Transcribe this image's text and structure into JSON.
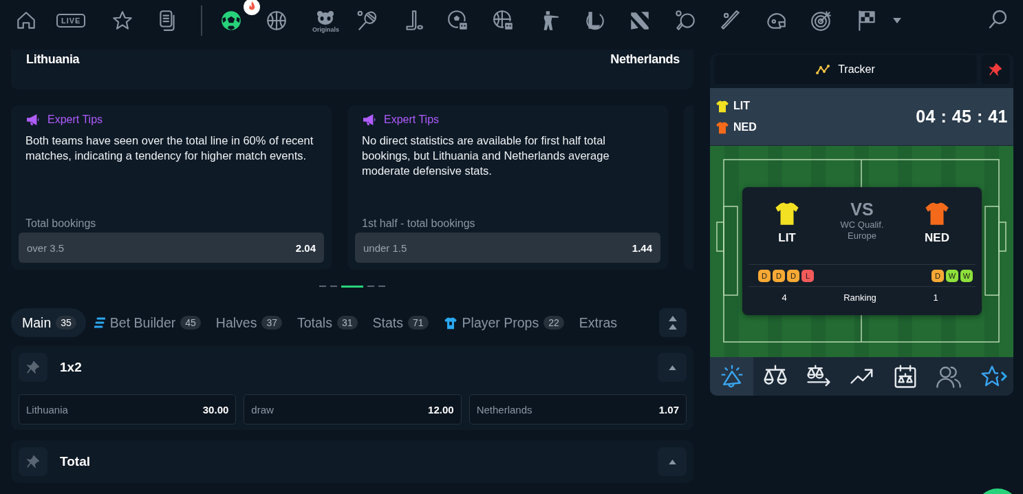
{
  "nav": [
    {
      "selected": false,
      "hot": false
    },
    {
      "label": "LIVE",
      "selected": false,
      "hot": false
    },
    {
      "selected": false,
      "hot": false
    },
    {
      "selected": false,
      "hot": false
    },
    {
      "selected": true,
      "hot": true
    },
    {
      "selected": false,
      "hot": false
    },
    {
      "label": "Originals",
      "selected": false,
      "hot": false
    },
    {
      "selected": false,
      "hot": false
    },
    {
      "selected": false,
      "hot": false
    },
    {
      "selected": false,
      "hot": false
    },
    {
      "selected": false,
      "hot": false
    },
    {
      "selected": false,
      "hot": false
    },
    {
      "selected": false,
      "hot": false
    },
    {
      "selected": false,
      "hot": false
    },
    {
      "selected": false,
      "hot": false
    },
    {
      "selected": false,
      "hot": false
    },
    {
      "selected": false,
      "hot": false
    },
    {
      "selected": false,
      "hot": false
    },
    {
      "selected": false,
      "hot": false
    }
  ],
  "match": {
    "home": "Lithuania",
    "away": "Netherlands"
  },
  "tips": [
    {
      "title": "Expert Tips",
      "text": "Both teams have seen over the total line in 60% of recent matches, indicating a tendency for higher match events.",
      "market": "Total bookings",
      "selection": "over 3.5",
      "odds": "2.04"
    },
    {
      "title": "Expert Tips",
      "text": "No direct statistics are available for first half total bookings, but Lithuania and Netherlands average moderate defensive stats.",
      "market": "1st half - total bookings",
      "selection": "under 1.5",
      "odds": "1.44"
    }
  ],
  "pager": [
    {
      "selected": false
    },
    {
      "selected": false
    },
    {
      "selected": true
    },
    {
      "selected": false
    },
    {
      "selected": false
    }
  ],
  "tabs": [
    {
      "kind": "plain",
      "label": "Main",
      "count": "35",
      "selected": true
    },
    {
      "kind": "builder",
      "label": "Bet Builder",
      "count": "45",
      "selected": false
    },
    {
      "kind": "plain",
      "label": "Halves",
      "count": "37",
      "selected": false
    },
    {
      "kind": "plain",
      "label": "Totals",
      "count": "31",
      "selected": false
    },
    {
      "kind": "plain",
      "label": "Stats",
      "count": "71",
      "selected": false
    },
    {
      "kind": "shirt",
      "label": "Player Props",
      "count": "22",
      "selected": false
    },
    {
      "kind": "plain",
      "label": "Extras",
      "selected": false
    }
  ],
  "markets": [
    {
      "title": "1x2",
      "expanded": true,
      "outcomes": [
        {
          "label": "Lithuania",
          "odds": "30.00"
        },
        {
          "label": "draw",
          "odds": "12.00"
        },
        {
          "label": "Netherlands",
          "odds": "1.07"
        }
      ]
    },
    {
      "title": "Total",
      "expanded": true
    }
  ],
  "tracker": {
    "label": "Tracker",
    "pinned": true,
    "home": {
      "code": "LIT",
      "card_code": "LIT",
      "color": "#f2e022",
      "form": [
        {
          "result": "D",
          "color": "#f7a934"
        },
        {
          "result": "D",
          "color": "#f7a934"
        },
        {
          "result": "D",
          "color": "#f7a934"
        },
        {
          "result": "L",
          "color": "#f25a5a"
        }
      ],
      "ranking": "4"
    },
    "away": {
      "code": "NED",
      "card_code": "NED",
      "color": "#f56a1a",
      "form": [
        {
          "result": "D",
          "color": "#f7a934"
        },
        {
          "result": "W",
          "color": "#8ee03a"
        },
        {
          "result": "W",
          "color": "#8ee03a"
        }
      ],
      "ranking": "1"
    },
    "timer": "04 : 45 : 41",
    "vs": "VS",
    "competition": "WC Qualif. Europe",
    "ranking_label": "Ranking",
    "tabs": [
      {
        "selected": true
      },
      {
        "selected": false
      },
      {
        "selected": false
      },
      {
        "selected": false
      },
      {
        "selected": false
      },
      {
        "selected": false
      },
      {
        "selected": false
      }
    ]
  }
}
